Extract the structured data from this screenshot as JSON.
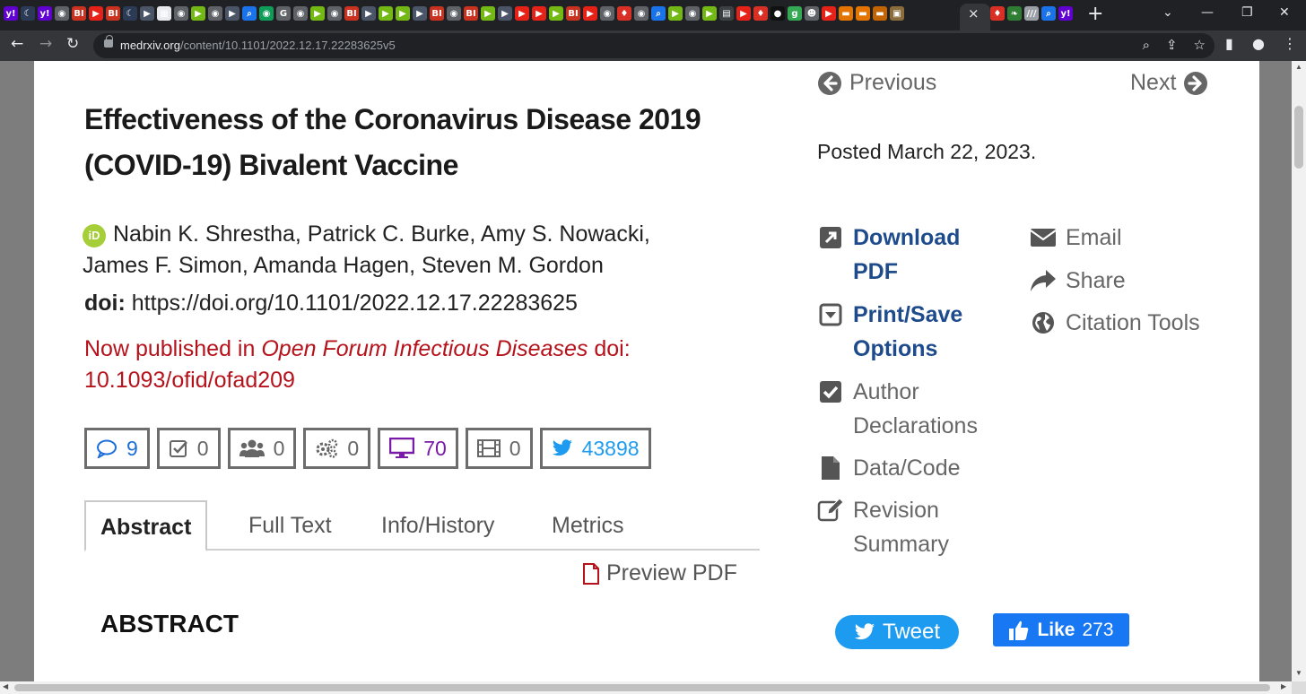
{
  "browser": {
    "url_host": "medrxiv.org",
    "url_path": "/content/10.1101/2022.12.17.22283625v5",
    "tab_close": "×",
    "new_tab": "+",
    "tab_favicons": [
      {
        "icon": "yahoo-icon",
        "glyph": "y!",
        "color": "#6001d2"
      },
      {
        "icon": "moon-icon",
        "glyph": "☾",
        "color": "#2b3a55"
      },
      {
        "icon": "yahoo-icon",
        "glyph": "y!",
        "color": "#6001d2"
      },
      {
        "icon": "globe-icon",
        "glyph": "◉",
        "color": "#5f6368"
      },
      {
        "icon": "bi-icon",
        "glyph": "BI",
        "color": "#c8321e"
      },
      {
        "icon": "youtube-icon",
        "glyph": "▶",
        "color": "#e62117"
      },
      {
        "icon": "bi-icon",
        "glyph": "BI",
        "color": "#c8321e"
      },
      {
        "icon": "moon-icon",
        "glyph": "☾",
        "color": "#2b3a55"
      },
      {
        "icon": "play-icon",
        "glyph": "▶",
        "color": "#4a5568"
      },
      {
        "icon": "image-icon",
        "glyph": "▦",
        "color": "#e8eaed"
      },
      {
        "icon": "globe-icon",
        "glyph": "◉",
        "color": "#5f6368"
      },
      {
        "icon": "rumble-icon",
        "glyph": "▶",
        "color": "#74b816"
      },
      {
        "icon": "globe-icon",
        "glyph": "◉",
        "color": "#5f6368"
      },
      {
        "icon": "play-icon",
        "glyph": "▶",
        "color": "#4a5568"
      },
      {
        "icon": "search-icon",
        "glyph": "⌕",
        "color": "#1a73e8"
      },
      {
        "icon": "globe-icon",
        "glyph": "◉",
        "color": "#0f9d58"
      },
      {
        "icon": "google-icon",
        "glyph": "G",
        "color": "#5f6368"
      },
      {
        "icon": "globe-icon",
        "glyph": "◉",
        "color": "#5f6368"
      },
      {
        "icon": "rumble-icon",
        "glyph": "▶",
        "color": "#74b816"
      },
      {
        "icon": "globe-icon",
        "glyph": "◉",
        "color": "#5f6368"
      },
      {
        "icon": "bi-icon",
        "glyph": "BI",
        "color": "#c8321e"
      },
      {
        "icon": "play-icon",
        "glyph": "▶",
        "color": "#4a5568"
      },
      {
        "icon": "rumble-icon",
        "glyph": "▶",
        "color": "#74b816"
      },
      {
        "icon": "rumble-icon",
        "glyph": "▶",
        "color": "#74b816"
      },
      {
        "icon": "play-icon",
        "glyph": "▶",
        "color": "#4a5568"
      },
      {
        "icon": "bi-icon",
        "glyph": "BI",
        "color": "#c8321e"
      },
      {
        "icon": "globe-icon",
        "glyph": "◉",
        "color": "#5f6368"
      },
      {
        "icon": "bi-icon",
        "glyph": "BI",
        "color": "#c8321e"
      },
      {
        "icon": "rumble-icon",
        "glyph": "▶",
        "color": "#74b816"
      },
      {
        "icon": "play-icon",
        "glyph": "▶",
        "color": "#4a5568"
      },
      {
        "icon": "youtube-icon",
        "glyph": "▶",
        "color": "#e62117"
      },
      {
        "icon": "youtube-icon",
        "glyph": "▶",
        "color": "#e62117"
      },
      {
        "icon": "rumble-icon",
        "glyph": "▶",
        "color": "#74b816"
      },
      {
        "icon": "bi-icon",
        "glyph": "BI",
        "color": "#c8321e"
      },
      {
        "icon": "youtube-icon",
        "glyph": "▶",
        "color": "#e62117"
      },
      {
        "icon": "globe-icon",
        "glyph": "◉",
        "color": "#5f6368"
      },
      {
        "icon": "mic-icon",
        "glyph": "♦",
        "color": "#d93025"
      },
      {
        "icon": "globe-icon",
        "glyph": "◉",
        "color": "#5f6368"
      },
      {
        "icon": "search-icon",
        "glyph": "⌕",
        "color": "#1a73e8"
      },
      {
        "icon": "rumble-icon",
        "glyph": "▶",
        "color": "#74b816"
      },
      {
        "icon": "globe-icon",
        "glyph": "◉",
        "color": "#5f6368"
      },
      {
        "icon": "rumble-icon",
        "glyph": "▶",
        "color": "#74b816"
      },
      {
        "icon": "news-icon",
        "glyph": "▤",
        "color": "#3c4043"
      },
      {
        "icon": "youtube-icon",
        "glyph": "▶",
        "color": "#e62117"
      },
      {
        "icon": "mic-icon",
        "glyph": "♦",
        "color": "#d93025"
      },
      {
        "icon": "circle-icon",
        "glyph": "●",
        "color": "#111111"
      },
      {
        "icon": "g-icon",
        "glyph": "g",
        "color": "#34a853"
      },
      {
        "icon": "person-icon",
        "glyph": "☻",
        "color": "#5f6368"
      },
      {
        "icon": "youtube-icon",
        "glyph": "▶",
        "color": "#e62117"
      },
      {
        "icon": "bookmark-icon",
        "glyph": "▬",
        "color": "#e37400"
      },
      {
        "icon": "bookmark-icon",
        "glyph": "▬",
        "color": "#e37400"
      },
      {
        "icon": "bookmark-icon",
        "glyph": "▬",
        "color": "#c26401"
      },
      {
        "icon": "photo-icon",
        "glyph": "▣",
        "color": "#8a6d3b"
      }
    ],
    "tab_favicons_after_active": [
      {
        "icon": "mic-icon",
        "glyph": "♦",
        "color": "#d93025"
      },
      {
        "icon": "leaf-icon",
        "glyph": "❧",
        "color": "#2e7d32"
      },
      {
        "icon": "text-icon",
        "glyph": "///",
        "color": "#9aa0a6"
      },
      {
        "icon": "search-icon",
        "glyph": "⌕",
        "color": "#1a73e8"
      },
      {
        "icon": "yahoo-icon",
        "glyph": "y!",
        "color": "#6001d2"
      }
    ]
  },
  "nav": {
    "previous": "Previous",
    "next": "Next"
  },
  "article": {
    "title": "Effectiveness of the Coronavirus Disease 2019 (COVID-19) Bivalent Vaccine",
    "authors_line1": "Nabin K. Shrestha, Patrick C. Burke, Amy S. Nowacki,",
    "authors_line2": "James F. Simon, Amanda Hagen, Steven M. Gordon",
    "orcid_label": "iD",
    "doi_label": "doi:",
    "doi_value": "https://doi.org/10.1101/2022.12.17.22283625",
    "published_prefix": "Now published in ",
    "published_journal": "Open Forum Infectious Diseases",
    "published_suffix": " doi:",
    "published_doi": "10.1093/ofid/ofad209",
    "posted": "Posted March 22, 2023."
  },
  "metrics": [
    {
      "name": "comments",
      "icon": "comment-icon",
      "value": "9"
    },
    {
      "name": "reviews",
      "icon": "checkbox-icon",
      "value": "0"
    },
    {
      "name": "community",
      "icon": "users-icon",
      "value": "0"
    },
    {
      "name": "automated",
      "icon": "gears-icon",
      "value": "0"
    },
    {
      "name": "views",
      "icon": "monitor-icon",
      "value": "70"
    },
    {
      "name": "media",
      "icon": "film-icon",
      "value": "0"
    },
    {
      "name": "tweets",
      "icon": "twitter-icon",
      "value": "43898"
    }
  ],
  "tabs": [
    {
      "label": "Abstract",
      "active": true
    },
    {
      "label": "Full Text",
      "active": false
    },
    {
      "label": "Info/History",
      "active": false
    },
    {
      "label": "Metrics",
      "active": false
    }
  ],
  "preview_pdf": "Preview PDF",
  "abstract_heading": "ABSTRACT",
  "sidebar": {
    "download_line1": "Download",
    "download_line2": "PDF",
    "print_line1": "Print/Save",
    "print_line2": "Options",
    "author_line1": "Author",
    "author_line2": "Declarations",
    "data_code": "Data/Code",
    "revision_line1": "Revision",
    "revision_line2": "Summary",
    "email": "Email",
    "share": "Share",
    "citation": "Citation Tools"
  },
  "social": {
    "tweet_label": "Tweet",
    "like_label": "Like",
    "like_count": "273"
  },
  "colors": {
    "accent_link": "#1e4b8c",
    "published_red": "#b5121b",
    "twitter_blue": "#1d9bf0",
    "facebook_blue": "#1877f2"
  }
}
